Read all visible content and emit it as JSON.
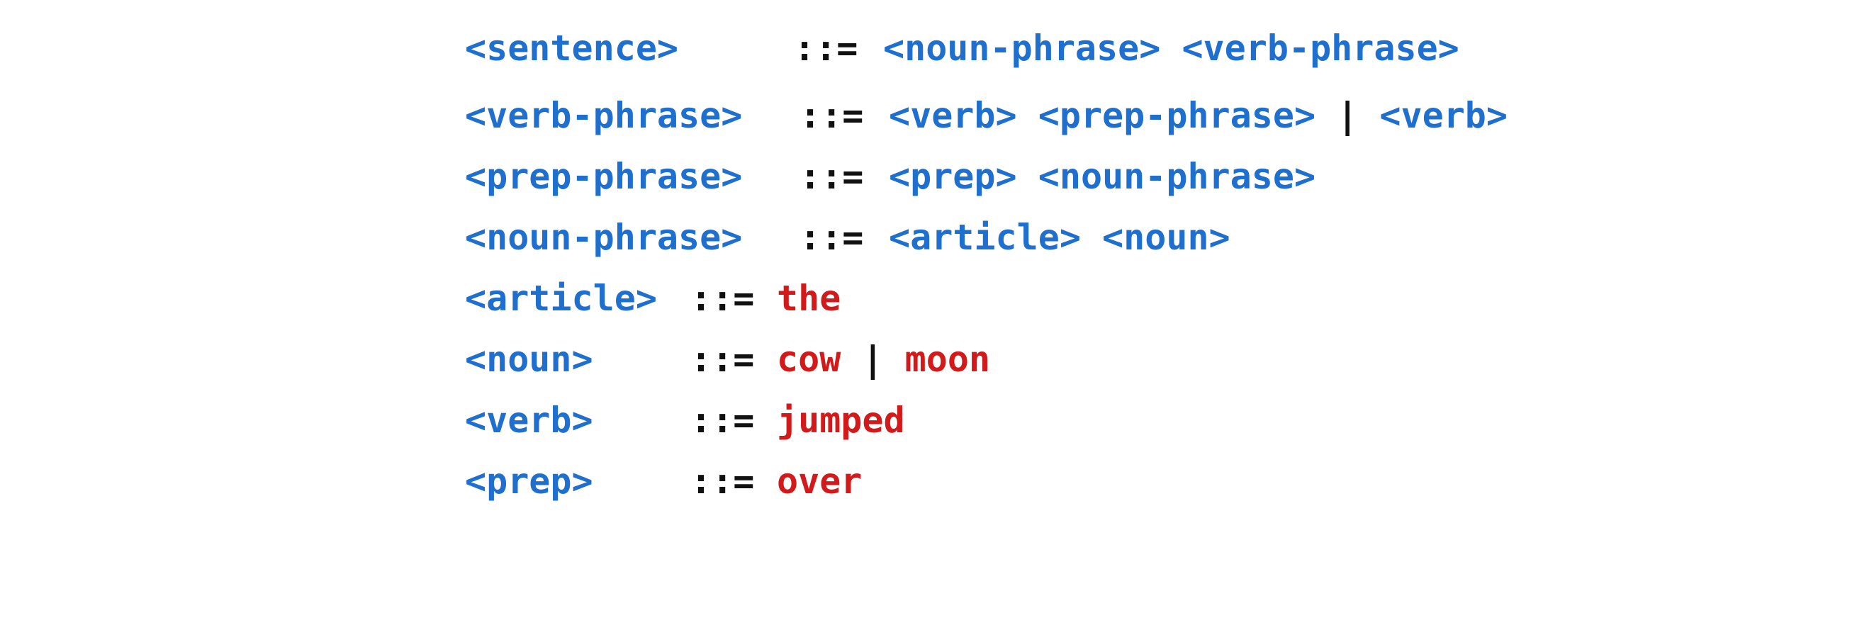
{
  "grammar": {
    "rules": [
      {
        "lhs": "<sentence>",
        "def": "::=",
        "rhs": [
          {
            "text": "<noun-phrase>",
            "kind": "nonterminal"
          },
          {
            "text": " ",
            "kind": "space"
          },
          {
            "text": "<verb-phrase>",
            "kind": "nonterminal"
          }
        ]
      },
      {
        "lhs": "<verb-phrase>",
        "def": "::=",
        "rhs": [
          {
            "text": "<verb>",
            "kind": "nonterminal"
          },
          {
            "text": " ",
            "kind": "space"
          },
          {
            "text": "<prep-phrase>",
            "kind": "nonterminal"
          },
          {
            "text": " | ",
            "kind": "symbol"
          },
          {
            "text": "<verb>",
            "kind": "nonterminal"
          }
        ]
      },
      {
        "lhs": "<prep-phrase>",
        "def": "::=",
        "rhs": [
          {
            "text": "<prep>",
            "kind": "nonterminal"
          },
          {
            "text": " ",
            "kind": "space"
          },
          {
            "text": "<noun-phrase>",
            "kind": "nonterminal"
          }
        ]
      },
      {
        "lhs": "<noun-phrase>",
        "def": "::=",
        "rhs": [
          {
            "text": "<article>",
            "kind": "nonterminal"
          },
          {
            "text": " ",
            "kind": "space"
          },
          {
            "text": "<noun>",
            "kind": "nonterminal"
          }
        ]
      },
      {
        "lhs": "<article>",
        "def": "::=",
        "rhs": [
          {
            "text": "the",
            "kind": "terminal"
          }
        ]
      },
      {
        "lhs": "<noun>",
        "def": "::=",
        "rhs": [
          {
            "text": "cow",
            "kind": "terminal"
          },
          {
            "text": " | ",
            "kind": "symbol"
          },
          {
            "text": "moon",
            "kind": "terminal"
          }
        ]
      },
      {
        "lhs": "<verb>",
        "def": "::=",
        "rhs": [
          {
            "text": "jumped",
            "kind": "terminal"
          }
        ]
      },
      {
        "lhs": "<prep>",
        "def": "::=",
        "rhs": [
          {
            "text": "over",
            "kind": "terminal"
          }
        ]
      }
    ]
  },
  "colors": {
    "nonterminal": "#1f6fcf",
    "terminal": "#d21a1a",
    "symbol": "#111111"
  }
}
